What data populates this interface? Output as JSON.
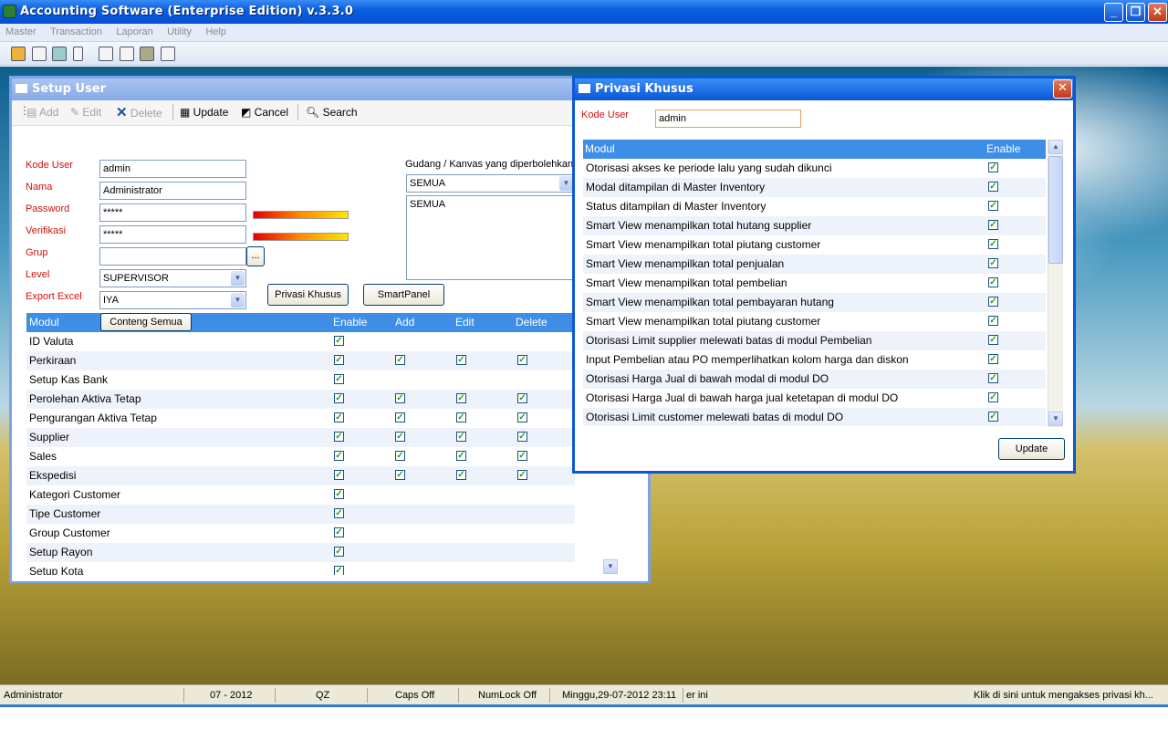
{
  "app": {
    "title": "Accounting Software (Enterprise Edition) v.3.3.0",
    "menus": [
      "Master",
      "Transaction",
      "Laporan",
      "Utility",
      "Help"
    ]
  },
  "setup_user": {
    "title": "Setup User",
    "toolbar": {
      "add": "Add",
      "edit": "Edit",
      "delete": "Delete",
      "update": "Update",
      "cancel": "Cancel",
      "search": "Search"
    },
    "labels": {
      "kode_user": "Kode User",
      "nama": "Nama",
      "password": "Password",
      "verifikasi": "Verifikasi",
      "grup": "Grup",
      "level": "Level",
      "export_excel": "Export Excel",
      "gudang": "Gudang / Kanvas yang diperbolehkan"
    },
    "values": {
      "kode_user": "admin",
      "nama": "Administrator",
      "password": "*****",
      "verifikasi": "*****",
      "grup": "",
      "grup_button": "...",
      "level": "SUPERVISOR",
      "export_excel": "IYA",
      "gudang_select": "SEMUA",
      "gudang_list": "SEMUA"
    },
    "buttons": {
      "privasi": "Privasi Khusus",
      "smartpanel": "SmartPanel",
      "conteng": "Conteng Semua"
    },
    "grid": {
      "columns": [
        "Modul",
        "Enable",
        "Add",
        "Edit",
        "Delete"
      ],
      "rows": [
        {
          "modul": "ID Valuta",
          "enable": true,
          "add": false,
          "edit": false,
          "delete": false
        },
        {
          "modul": "Perkiraan",
          "enable": true,
          "add": true,
          "edit": true,
          "delete": true
        },
        {
          "modul": "Setup Kas Bank",
          "enable": true,
          "add": false,
          "edit": false,
          "delete": false
        },
        {
          "modul": "Perolehan Aktiva Tetap",
          "enable": true,
          "add": true,
          "edit": true,
          "delete": true
        },
        {
          "modul": "Pengurangan Aktiva Tetap",
          "enable": true,
          "add": true,
          "edit": true,
          "delete": true
        },
        {
          "modul": "Supplier",
          "enable": true,
          "add": true,
          "edit": true,
          "delete": true
        },
        {
          "modul": "Sales",
          "enable": true,
          "add": true,
          "edit": true,
          "delete": true
        },
        {
          "modul": "Ekspedisi",
          "enable": true,
          "add": true,
          "edit": true,
          "delete": true
        },
        {
          "modul": "Kategori Customer",
          "enable": true,
          "add": false,
          "edit": false,
          "delete": false
        },
        {
          "modul": "Tipe Customer",
          "enable": true,
          "add": false,
          "edit": false,
          "delete": false
        },
        {
          "modul": "Group Customer",
          "enable": true,
          "add": false,
          "edit": false,
          "delete": false
        },
        {
          "modul": "Setup Rayon",
          "enable": true,
          "add": false,
          "edit": false,
          "delete": false
        },
        {
          "modul": "Setup Kota",
          "enable": true,
          "add": false,
          "edit": false,
          "delete": false
        }
      ]
    }
  },
  "privasi_khusus": {
    "title": "Privasi Khusus",
    "kode_user_label": "Kode User",
    "kode_user_value": "admin",
    "columns": [
      "Modul",
      "Enable"
    ],
    "rows": [
      "Otorisasi akses ke periode lalu yang sudah dikunci",
      "Modal ditampilan di Master Inventory",
      "Status ditampilan di Master Inventory",
      "Smart View menampilkan total hutang supplier",
      "Smart View menampilkan total piutang customer",
      "Smart View menampilkan total penjualan",
      "Smart View menampilkan total pembelian",
      "Smart View menampilkan total pembayaran hutang",
      "Smart View menampilkan total piutang customer",
      "Otorisasi Limit supplier melewati batas di modul Pembelian",
      "Input Pembelian atau PO memperlihatkan kolom harga dan diskon",
      "Otorisasi Harga Jual di bawah modal di modul DO",
      "Otorisasi Harga Jual di bawah harga jual ketetapan di modul DO",
      "Otorisasi Limit customer melewati batas di modul DO"
    ],
    "update_label": "Update"
  },
  "statusbar": {
    "user": "Administrator",
    "period": "07 - 2012",
    "code": "QZ",
    "caps": "Caps Off",
    "numlock": "NumLock Off",
    "datetime": "Minggu,29-07-2012 23:11",
    "extra": "er ini",
    "hint": "Klik di sini untuk mengakses privasi kh..."
  },
  "colors": {
    "titlebar": "#0a5fe0",
    "grid_header": "#3e8ee8",
    "label_red": "#d01010"
  }
}
